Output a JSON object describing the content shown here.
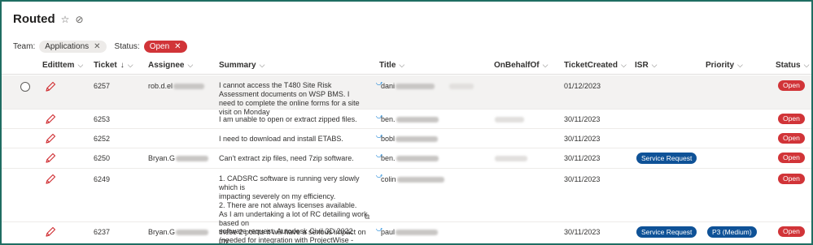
{
  "view": {
    "title": "Routed",
    "star_icon": "star-outline-icon",
    "check_icon": "checkmark-circle-icon"
  },
  "filters": {
    "team_label": "Team:",
    "team_chip": "Applications",
    "status_label": "Status:",
    "status_chip": "Open",
    "chip_close": "✕"
  },
  "columns": {
    "edit": "EditItem",
    "ticket": "Ticket",
    "ticket_sort": "↓",
    "assignee": "Assignee",
    "summary": "Summary",
    "title": "Title",
    "onbehalf": "OnBehalfOf",
    "created": "TicketCreated",
    "isr": "ISR",
    "priority": "Priority",
    "status": "Status"
  },
  "colors": {
    "accent": "#1f6d62",
    "open_badge": "#d13438",
    "blue_badge": "#0f5297",
    "pencil": "#d13438"
  },
  "rows": [
    {
      "ticket": "6257",
      "assignee": "rob.d.el",
      "summary": "I cannot access the T480 Site Risk Assessment documents on WSP BMS. I need to complete the online forms for a site visit on Monday",
      "title": "dani",
      "created": "01/12/2023",
      "isr": "",
      "priority": "",
      "status": "Open"
    },
    {
      "ticket": "6253",
      "assignee": "",
      "summary": "I am unable to open or extract zipped files.",
      "title": "ben.",
      "created": "30/11/2023",
      "isr": "",
      "priority": "",
      "status": "Open"
    },
    {
      "ticket": "6252",
      "assignee": "",
      "summary": "I need to download and install ETABS.",
      "title": "bobl",
      "created": "30/11/2023",
      "isr": "",
      "priority": "",
      "status": "Open"
    },
    {
      "ticket": "6250",
      "assignee": "Bryan.G",
      "summary": "Can't extract zip files, need 7zip software.",
      "title": "ben.",
      "created": "30/11/2023",
      "isr": "Service Request",
      "priority": "",
      "status": "Open"
    },
    {
      "ticket": "6249",
      "assignee": "",
      "summary_lines": [
        "1. CADSRC software is running very slowly which is",
        "impacting severely on my efficiency.",
        "2. There are not always licenses available.",
        "As I am undertaking a lot of RC detailing work based on",
        "these 2 points it will have a serious impact on my"
      ],
      "title": "colin",
      "created": "30/11/2023",
      "isr": "",
      "priority": "",
      "status": "Open"
    },
    {
      "ticket": "6237",
      "assignee": "Bryan.G",
      "summary_lines": [
        "software request: Autodesk Civil 3D 2022",
        "(needed for integration with ProjectWise - Integration for"
      ],
      "title": "paul",
      "created": "30/11/2023",
      "isr": "Service Request",
      "priority": "P3 (Medium)",
      "status": "Open"
    }
  ]
}
